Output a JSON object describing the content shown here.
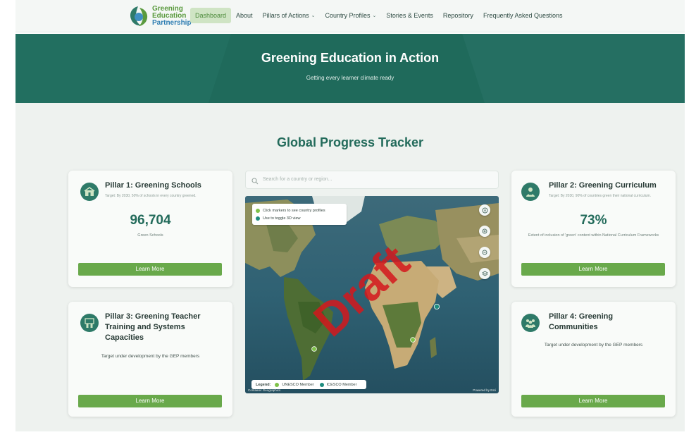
{
  "logo": {
    "line1": "Greening",
    "line2": "Education",
    "line3": "Partnership",
    "tagline": "Getting every learner climate ready"
  },
  "nav": {
    "items": [
      {
        "label": "Dashboard",
        "active": true,
        "dropdown": false
      },
      {
        "label": "About",
        "active": false,
        "dropdown": false
      },
      {
        "label": "Pillars of Actions",
        "active": false,
        "dropdown": true
      },
      {
        "label": "Country Profiles",
        "active": false,
        "dropdown": true
      },
      {
        "label": "Stories & Events",
        "active": false,
        "dropdown": false
      },
      {
        "label": "Repository",
        "active": false,
        "dropdown": false
      },
      {
        "label": "Frequently Asked Questions",
        "active": false,
        "dropdown": false
      }
    ]
  },
  "hero": {
    "title": "Greening Education in Action",
    "subtitle": "Getting every learner climate ready"
  },
  "main": {
    "title": "Global Progress Tracker"
  },
  "pillars": {
    "p1": {
      "title": "Pillar 1: Greening Schools",
      "target": "Target: By 2030, 50% of schools in every country greened.",
      "metric": "96,704",
      "metric_label": "Green Schools",
      "button": "Learn More"
    },
    "p2": {
      "title": "Pillar 2: Greening Curriculum",
      "target": "Target: By 2030, 90% of countries green their national curriculum.",
      "metric": "73%",
      "metric_label": "Extent of inclusion of 'green' content within National Curriculum Frameworks",
      "button": "Learn More"
    },
    "p3": {
      "title_l1": "Pillar 3: Greening Teacher",
      "title_l2": "Training and Systems",
      "title_l3": "Capacities",
      "note": "Target under development by the GEP members",
      "button": "Learn More"
    },
    "p4": {
      "title_l1": "Pillar 4: Greening",
      "title_l2": "Communities",
      "note": "Target under development by the GEP members",
      "button": "Learn More"
    }
  },
  "search": {
    "placeholder": "Search for a country or region..."
  },
  "map": {
    "info": [
      "Click markers to see country profiles",
      "Use  to toggle 3D view"
    ],
    "legend_title": "Legend:",
    "legend": [
      {
        "label": "UNESCO Member",
        "color": "#7fc24a"
      },
      {
        "label": "ICESCO Member",
        "color": "#1e8c7e"
      }
    ],
    "attribution_left": "Container Geographics",
    "attribution_right": "Powered by Esri",
    "watermark": "Draft"
  },
  "colors": {
    "brand_dark": "#1f6a5b",
    "accent_green": "#69a94b",
    "watermark_red": "#d5181d"
  }
}
